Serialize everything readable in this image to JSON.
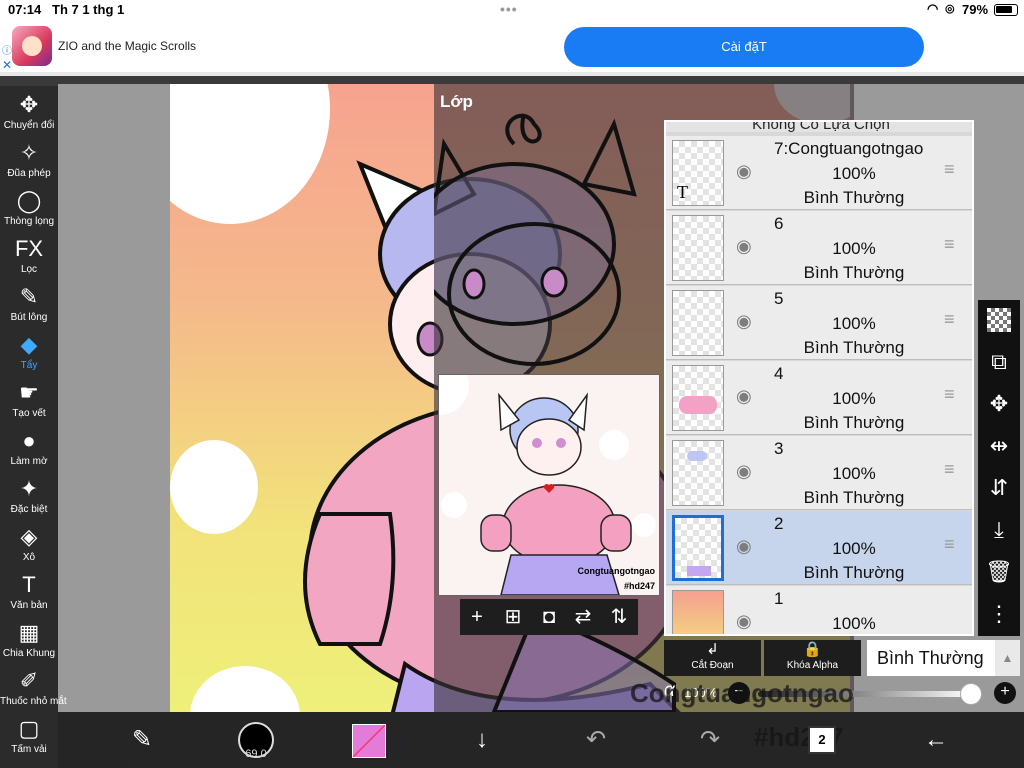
{
  "status_bar": {
    "time": "07:14",
    "date": "Th 7 1 thg 1",
    "battery": "79%"
  },
  "ad": {
    "title": "ZIO and the Magic Scrolls",
    "cta": "Cài đặT"
  },
  "left_tools": [
    {
      "label": "Chuyển đổi",
      "icon": "move-icon"
    },
    {
      "label": "Đũa phép",
      "icon": "magic-wand-icon"
    },
    {
      "label": "Thòng lọng",
      "icon": "lasso-icon"
    },
    {
      "label": "Lọc",
      "icon": "fx-icon"
    },
    {
      "label": "Bút lông",
      "icon": "brush-icon"
    },
    {
      "label": "Tẩy",
      "icon": "eraser-icon"
    },
    {
      "label": "Tạo vết",
      "icon": "smudge-icon"
    },
    {
      "label": "Làm mờ",
      "icon": "blur-drop-icon"
    },
    {
      "label": "Đặc biệt",
      "icon": "special-sparkle-icon"
    },
    {
      "label": "Xô",
      "icon": "bucket-icon"
    },
    {
      "label": "Văn bản",
      "icon": "text-icon"
    },
    {
      "label": "Chia Khung",
      "icon": "frame-divider-icon"
    },
    {
      "label": "Thuốc nhỏ mắt",
      "icon": "eyedropper-icon"
    },
    {
      "label": "Tấm vải",
      "icon": "canvas-icon"
    }
  ],
  "active_tool": "Tẩy",
  "layer_panel": {
    "title": "Lớp",
    "top_label": "Không Có Lựa Chọn",
    "layers": [
      {
        "name": "7:Congtuangotngao",
        "opacity": "100%",
        "blend": "Bình Thường"
      },
      {
        "name": "6",
        "opacity": "100%",
        "blend": "Bình Thường"
      },
      {
        "name": "5",
        "opacity": "100%",
        "blend": "Bình Thường"
      },
      {
        "name": "4",
        "opacity": "100%",
        "blend": "Bình Thường"
      },
      {
        "name": "3",
        "opacity": "100%",
        "blend": "Bình Thường"
      },
      {
        "name": "2",
        "opacity": "100%",
        "blend": "Bình Thường"
      },
      {
        "name": "1",
        "opacity": "100%",
        "blend": ""
      }
    ],
    "selected_layer": "2",
    "clip_label": "Cắt Đoạn",
    "alpha_lock_label": "Khóa Alpha",
    "blend_mode": "Bình Thường",
    "alpha_symbol": "α",
    "opacity_value": "100%",
    "opacity_fraction": 1.0
  },
  "preview": {
    "signature": "Congtuangotngao",
    "tag": "#hd247"
  },
  "canvas_overlay_text": {
    "signature": "Congtuangotngao",
    "tag": "#hd247"
  },
  "bottom_bar": {
    "brush_size": "69.0",
    "layer_count": "2",
    "color": "#e37bd8"
  }
}
